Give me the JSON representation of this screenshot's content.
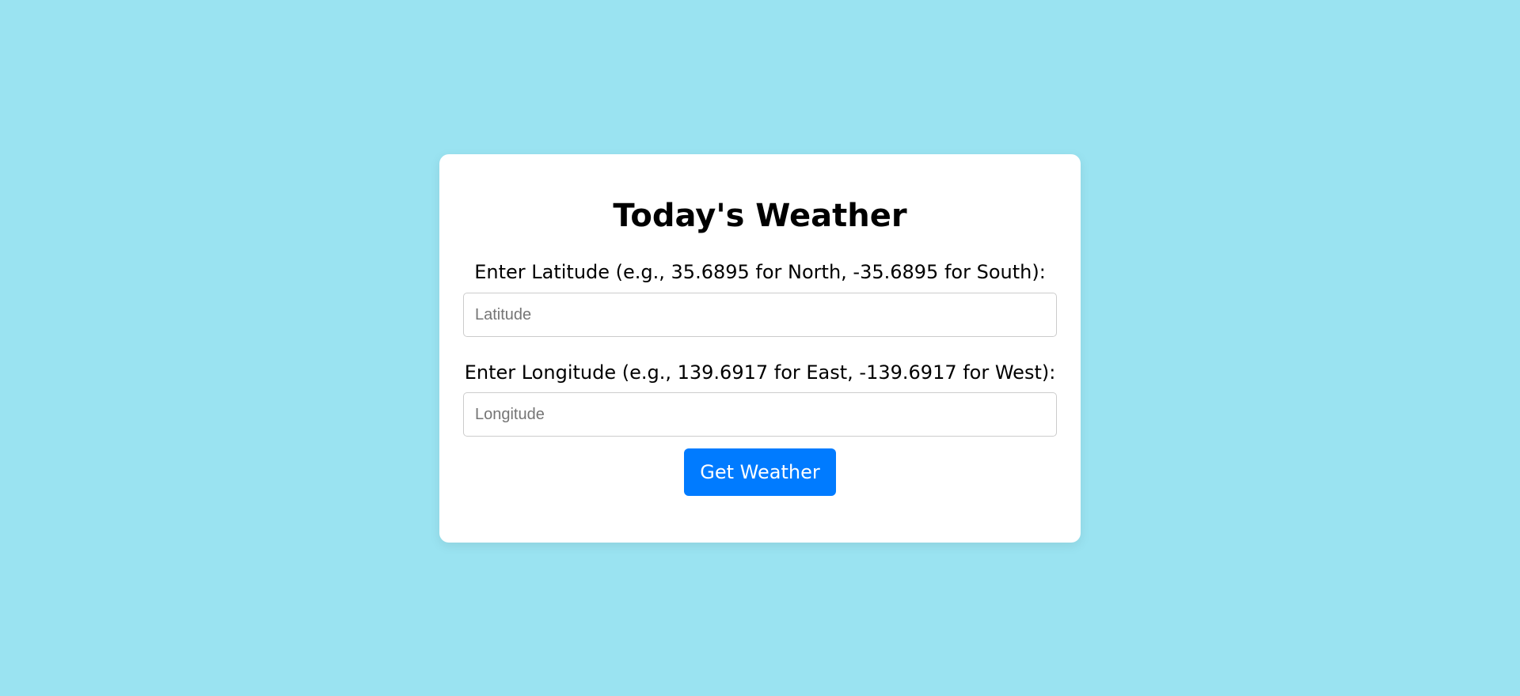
{
  "weather_form": {
    "title": "Today's Weather",
    "latitude": {
      "label": "Enter Latitude (e.g., 35.6895 for North, -35.6895 for South):",
      "placeholder": "Latitude",
      "value": ""
    },
    "longitude": {
      "label": "Enter Longitude (e.g., 139.6917 for East, -139.6917 for West):",
      "placeholder": "Longitude",
      "value": ""
    },
    "submit_label": "Get Weather"
  },
  "colors": {
    "background": "#9ae3f1",
    "card": "#ffffff",
    "button": "#007bff",
    "button_text": "#ffffff"
  }
}
